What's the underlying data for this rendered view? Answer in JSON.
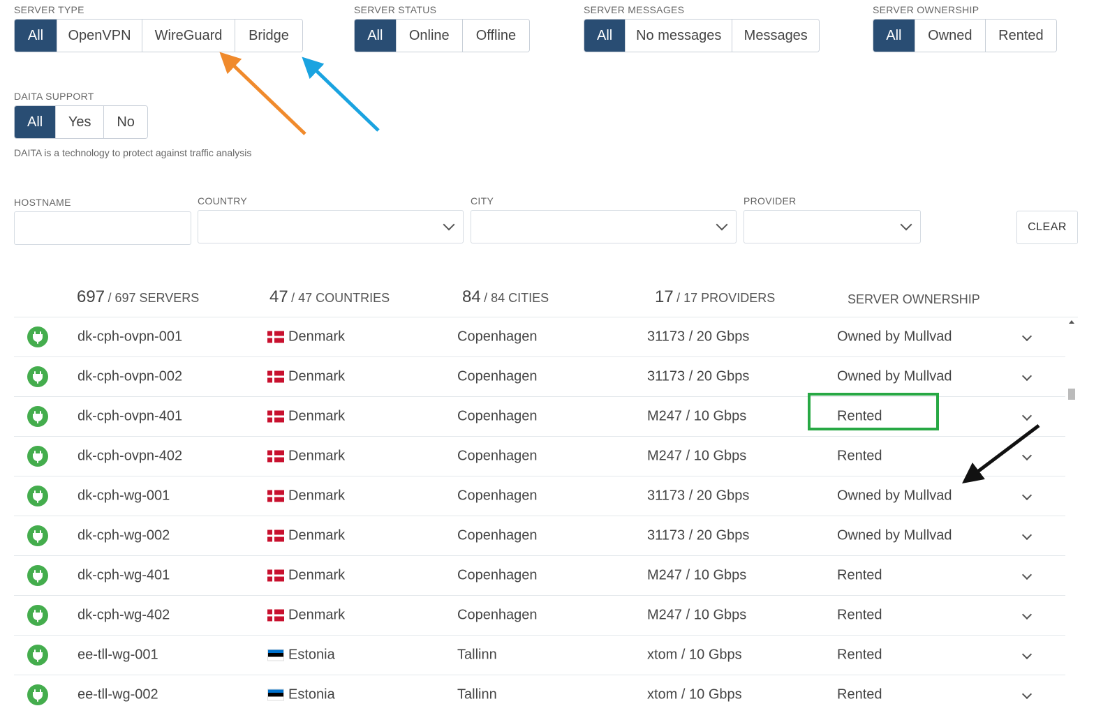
{
  "filters": {
    "server_type": {
      "label": "SERVER TYPE",
      "options": [
        "All",
        "OpenVPN",
        "WireGuard",
        "Bridge"
      ],
      "selected": "All"
    },
    "server_status": {
      "label": "SERVER STATUS",
      "options": [
        "All",
        "Online",
        "Offline"
      ],
      "selected": "All"
    },
    "server_messages": {
      "label": "SERVER MESSAGES",
      "options": [
        "All",
        "No messages",
        "Messages"
      ],
      "selected": "All"
    },
    "server_ownership": {
      "label": "SERVER OWNERSHIP",
      "options": [
        "All",
        "Owned",
        "Rented"
      ],
      "selected": "All"
    },
    "daita_support": {
      "label": "DAITA SUPPORT",
      "options": [
        "All",
        "Yes",
        "No"
      ],
      "selected": "All",
      "note": "DAITA is a technology to protect against traffic analysis"
    }
  },
  "search": {
    "hostname_label": "HOSTNAME",
    "hostname_value": "",
    "country_label": "COUNTRY",
    "city_label": "CITY",
    "provider_label": "PROVIDER",
    "clear_label": "CLEAR"
  },
  "summary": {
    "servers_shown": "697",
    "servers_total": "/ 697 SERVERS",
    "countries_shown": "47",
    "countries_total": "/ 47 COUNTRIES",
    "cities_shown": "84",
    "cities_total": "/ 84 CITIES",
    "providers_shown": "17",
    "providers_total": "/ 17 PROVIDERS",
    "ownership_header": "SERVER OWNERSHIP"
  },
  "rows": [
    {
      "hostname": "dk-cph-ovpn-001",
      "country": "Denmark",
      "flag": "dk",
      "city": "Copenhagen",
      "provider": "31173 / 20 Gbps",
      "ownership": "Owned by Mullvad",
      "status": "online"
    },
    {
      "hostname": "dk-cph-ovpn-002",
      "country": "Denmark",
      "flag": "dk",
      "city": "Copenhagen",
      "provider": "31173 / 20 Gbps",
      "ownership": "Owned by Mullvad",
      "status": "online"
    },
    {
      "hostname": "dk-cph-ovpn-401",
      "country": "Denmark",
      "flag": "dk",
      "city": "Copenhagen",
      "provider": "M247 / 10 Gbps",
      "ownership": "Rented",
      "status": "online"
    },
    {
      "hostname": "dk-cph-ovpn-402",
      "country": "Denmark",
      "flag": "dk",
      "city": "Copenhagen",
      "provider": "M247 / 10 Gbps",
      "ownership": "Rented",
      "status": "online"
    },
    {
      "hostname": "dk-cph-wg-001",
      "country": "Denmark",
      "flag": "dk",
      "city": "Copenhagen",
      "provider": "31173 / 20 Gbps",
      "ownership": "Owned by Mullvad",
      "status": "online"
    },
    {
      "hostname": "dk-cph-wg-002",
      "country": "Denmark",
      "flag": "dk",
      "city": "Copenhagen",
      "provider": "31173 / 20 Gbps",
      "ownership": "Owned by Mullvad",
      "status": "online"
    },
    {
      "hostname": "dk-cph-wg-401",
      "country": "Denmark",
      "flag": "dk",
      "city": "Copenhagen",
      "provider": "M247 / 10 Gbps",
      "ownership": "Rented",
      "status": "online"
    },
    {
      "hostname": "dk-cph-wg-402",
      "country": "Denmark",
      "flag": "dk",
      "city": "Copenhagen",
      "provider": "M247 / 10 Gbps",
      "ownership": "Rented",
      "status": "online"
    },
    {
      "hostname": "ee-tll-wg-001",
      "country": "Estonia",
      "flag": "ee",
      "city": "Tallinn",
      "provider": "xtom / 10 Gbps",
      "ownership": "Rented",
      "status": "online"
    },
    {
      "hostname": "ee-tll-wg-002",
      "country": "Estonia",
      "flag": "ee",
      "city": "Tallinn",
      "provider": "xtom / 10 Gbps",
      "ownership": "Rented",
      "status": "online"
    }
  ],
  "colors": {
    "active_segment": "#294d73",
    "status_online": "#44ad4d",
    "highlight_box": "#27a844",
    "arrow_orange": "#f08a2c",
    "arrow_blue": "#1aa3e0",
    "arrow_black": "#111111"
  }
}
